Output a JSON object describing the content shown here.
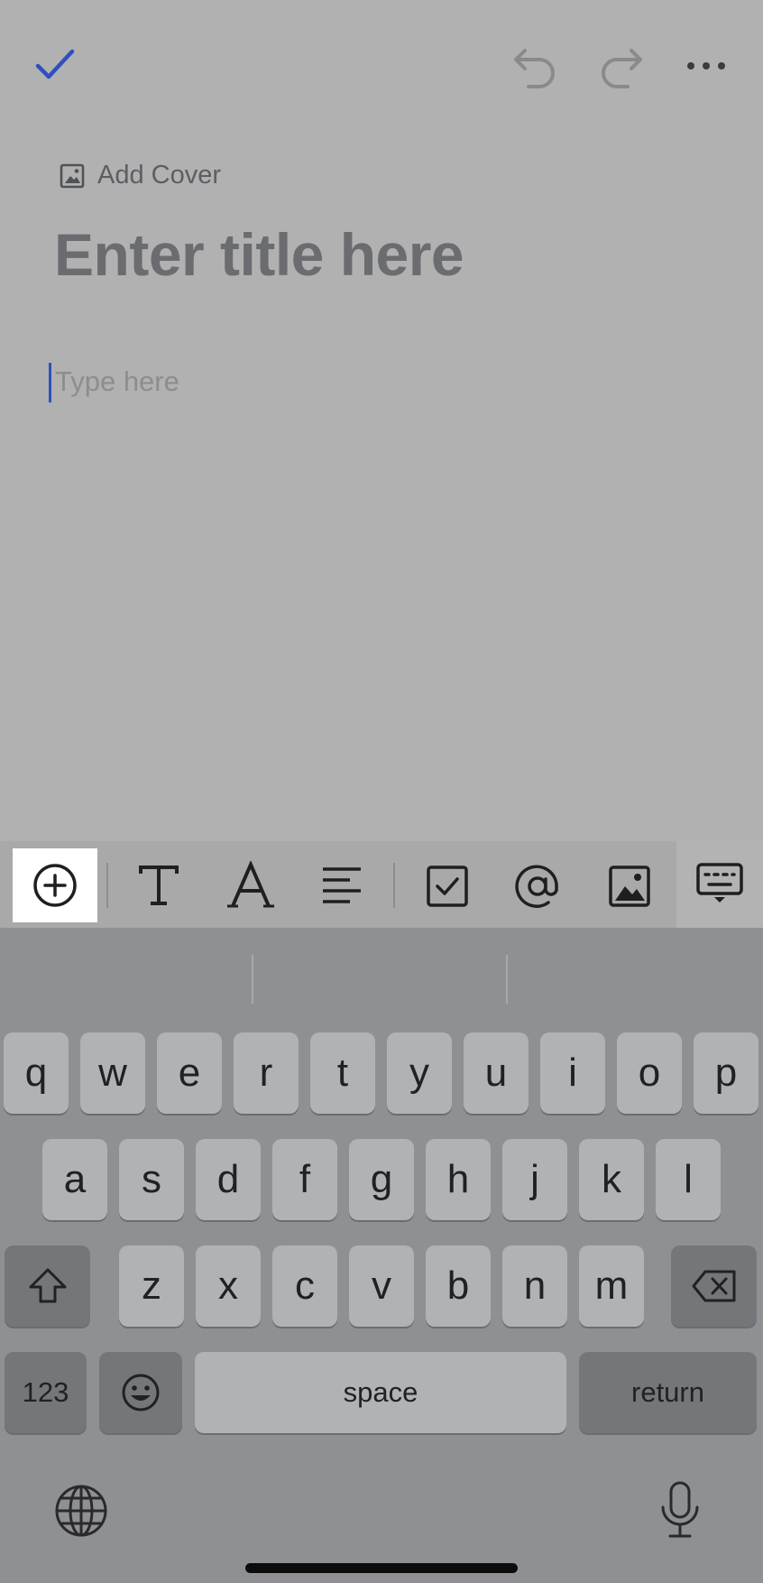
{
  "editor": {
    "add_cover_label": "Add Cover",
    "title_placeholder": "Enter title here",
    "body_placeholder": "Type here"
  },
  "topbar": {
    "icons": [
      "check-icon",
      "undo-icon",
      "redo-icon",
      "more-icon"
    ]
  },
  "toolbar": {
    "icons": [
      "insert-plus-icon",
      "text-style-icon",
      "font-color-icon",
      "align-icon",
      "checkbox-icon",
      "mention-icon",
      "image-icon",
      "keyboard-hide-icon"
    ]
  },
  "keyboard": {
    "row1": [
      "q",
      "w",
      "e",
      "r",
      "t",
      "y",
      "u",
      "i",
      "o",
      "p"
    ],
    "row2": [
      "a",
      "s",
      "d",
      "f",
      "g",
      "h",
      "j",
      "k",
      "l"
    ],
    "row3": [
      "z",
      "x",
      "c",
      "v",
      "b",
      "n",
      "m"
    ],
    "numbers_label": "123",
    "space_label": "space",
    "return_label": "return"
  },
  "colors": {
    "accent": "#2f4fbf",
    "overlay": "#b1b1b1"
  }
}
